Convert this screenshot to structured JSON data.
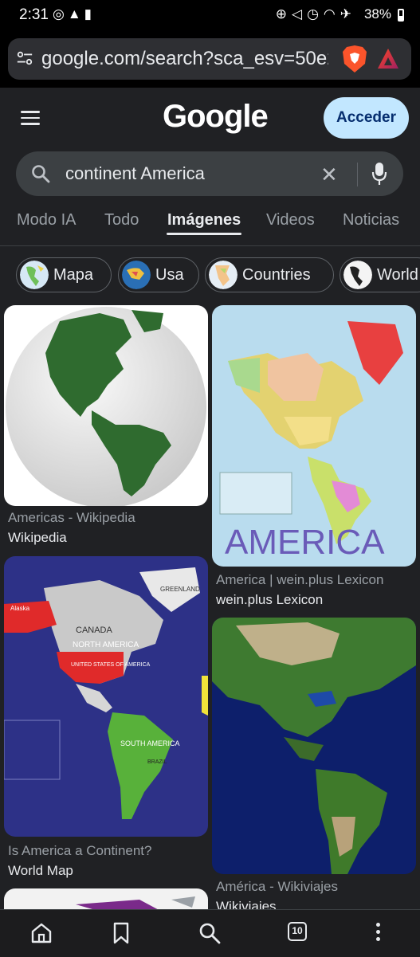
{
  "status_bar": {
    "time": "2:31",
    "battery": "38%",
    "icons_left": [
      "whatsapp-icon",
      "warning-icon",
      "battery-saver-icon"
    ],
    "icons_right": [
      "data-saver-icon",
      "mute-icon",
      "alarm-icon",
      "wifi-icon",
      "airplane-icon",
      "battery-icon"
    ]
  },
  "browser": {
    "url": "google.com/search?sca_esv=50e2l",
    "tabs_count": "10"
  },
  "google": {
    "logo": "Google",
    "signin_label": "Acceder",
    "query": "continent America",
    "tabs": [
      {
        "label": "Modo IA"
      },
      {
        "label": "Todo"
      },
      {
        "label": "Imágenes"
      },
      {
        "label": "Videos"
      },
      {
        "label": "Noticias"
      }
    ],
    "active_tab": "Imágenes"
  },
  "chips": [
    {
      "label": "Mapa"
    },
    {
      "label": "Usa"
    },
    {
      "label": "Countries"
    },
    {
      "label": "World"
    }
  ],
  "results": [
    {
      "title": "Americas - Wikipedia",
      "source": "Wikipedia"
    },
    {
      "title": "America | wein.plus Lexicon",
      "source": "wein.plus Lexicon"
    },
    {
      "title": "Is America a Continent?",
      "source": "World Map"
    },
    {
      "title": "América - Wikiviajes",
      "source": "Wikiviajes"
    }
  ],
  "map_labels": {
    "america": "AMERICA",
    "north_america": "NORTH AMERICA",
    "usa": "UNITED STATES OF AMERICA",
    "south_america": "SOUTH AMERICA",
    "canada": "CANADA",
    "greenland": "GREENLAND",
    "alaska": "Alaska",
    "brazil": "BRAZIL"
  },
  "colors": {
    "page_bg": "#202124",
    "search_bg": "#3c4043",
    "signin_bg": "#c2e7ff",
    "signin_text": "#062e6f"
  }
}
